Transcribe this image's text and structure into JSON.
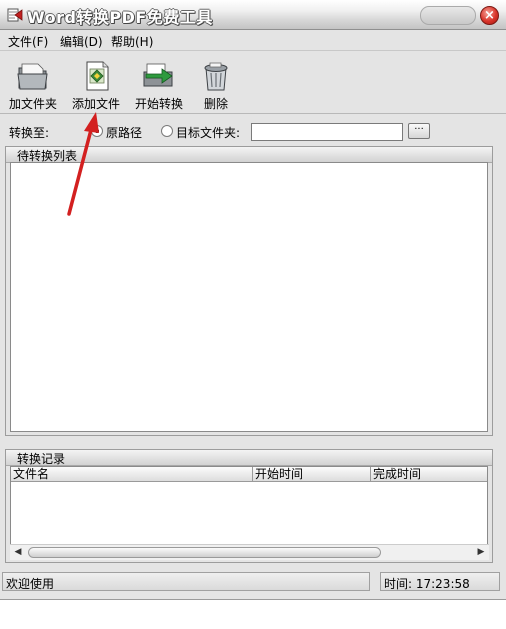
{
  "window": {
    "title": "Word转换PDF免费工具",
    "close_glyph": "×"
  },
  "menu": [
    {
      "label": "文件(F)"
    },
    {
      "label": "编辑(D)"
    },
    {
      "label": "帮助(H)"
    }
  ],
  "toolbar": [
    {
      "label": "加文件夹",
      "icon": "folder-icon"
    },
    {
      "label": "添加文件",
      "icon": "add-file-icon"
    },
    {
      "label": "开始转换",
      "icon": "convert-icon"
    },
    {
      "label": "删除",
      "icon": "delete-icon"
    }
  ],
  "convert_to": {
    "label": "转换至:",
    "options": [
      {
        "label": "原路径",
        "selected": true
      },
      {
        "label": "目标文件夹:",
        "selected": false
      }
    ],
    "target_path_value": "",
    "browse_label": "···"
  },
  "pending_list": {
    "title": "待转换列表"
  },
  "records": {
    "title": "转换记录",
    "columns": [
      "文件名",
      "开始时间",
      "完成时间"
    ],
    "scroll_left": "◀",
    "scroll_right": "▶"
  },
  "status": {
    "left": "欢迎使用",
    "right": "时间: 17:23:58"
  },
  "colors": {
    "window_bg": "#e4e4e4",
    "annotation_arrow": "#d32020",
    "close_button": "#d9342a"
  }
}
